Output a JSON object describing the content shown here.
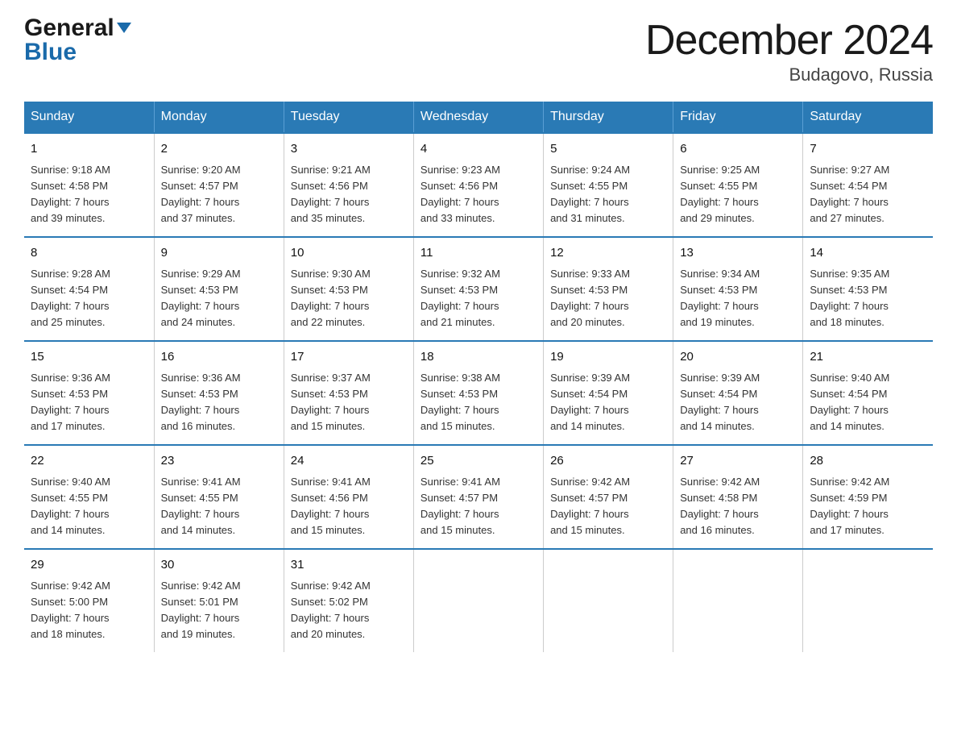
{
  "logo": {
    "general": "General",
    "blue": "Blue"
  },
  "title": {
    "month_year": "December 2024",
    "location": "Budagovo, Russia"
  },
  "days_of_week": [
    "Sunday",
    "Monday",
    "Tuesday",
    "Wednesday",
    "Thursday",
    "Friday",
    "Saturday"
  ],
  "weeks": [
    [
      {
        "day": "1",
        "sunrise": "9:18 AM",
        "sunset": "4:58 PM",
        "daylight": "7 hours and 39 minutes."
      },
      {
        "day": "2",
        "sunrise": "9:20 AM",
        "sunset": "4:57 PM",
        "daylight": "7 hours and 37 minutes."
      },
      {
        "day": "3",
        "sunrise": "9:21 AM",
        "sunset": "4:56 PM",
        "daylight": "7 hours and 35 minutes."
      },
      {
        "day": "4",
        "sunrise": "9:23 AM",
        "sunset": "4:56 PM",
        "daylight": "7 hours and 33 minutes."
      },
      {
        "day": "5",
        "sunrise": "9:24 AM",
        "sunset": "4:55 PM",
        "daylight": "7 hours and 31 minutes."
      },
      {
        "day": "6",
        "sunrise": "9:25 AM",
        "sunset": "4:55 PM",
        "daylight": "7 hours and 29 minutes."
      },
      {
        "day": "7",
        "sunrise": "9:27 AM",
        "sunset": "4:54 PM",
        "daylight": "7 hours and 27 minutes."
      }
    ],
    [
      {
        "day": "8",
        "sunrise": "9:28 AM",
        "sunset": "4:54 PM",
        "daylight": "7 hours and 25 minutes."
      },
      {
        "day": "9",
        "sunrise": "9:29 AM",
        "sunset": "4:53 PM",
        "daylight": "7 hours and 24 minutes."
      },
      {
        "day": "10",
        "sunrise": "9:30 AM",
        "sunset": "4:53 PM",
        "daylight": "7 hours and 22 minutes."
      },
      {
        "day": "11",
        "sunrise": "9:32 AM",
        "sunset": "4:53 PM",
        "daylight": "7 hours and 21 minutes."
      },
      {
        "day": "12",
        "sunrise": "9:33 AM",
        "sunset": "4:53 PM",
        "daylight": "7 hours and 20 minutes."
      },
      {
        "day": "13",
        "sunrise": "9:34 AM",
        "sunset": "4:53 PM",
        "daylight": "7 hours and 19 minutes."
      },
      {
        "day": "14",
        "sunrise": "9:35 AM",
        "sunset": "4:53 PM",
        "daylight": "7 hours and 18 minutes."
      }
    ],
    [
      {
        "day": "15",
        "sunrise": "9:36 AM",
        "sunset": "4:53 PM",
        "daylight": "7 hours and 17 minutes."
      },
      {
        "day": "16",
        "sunrise": "9:36 AM",
        "sunset": "4:53 PM",
        "daylight": "7 hours and 16 minutes."
      },
      {
        "day": "17",
        "sunrise": "9:37 AM",
        "sunset": "4:53 PM",
        "daylight": "7 hours and 15 minutes."
      },
      {
        "day": "18",
        "sunrise": "9:38 AM",
        "sunset": "4:53 PM",
        "daylight": "7 hours and 15 minutes."
      },
      {
        "day": "19",
        "sunrise": "9:39 AM",
        "sunset": "4:54 PM",
        "daylight": "7 hours and 14 minutes."
      },
      {
        "day": "20",
        "sunrise": "9:39 AM",
        "sunset": "4:54 PM",
        "daylight": "7 hours and 14 minutes."
      },
      {
        "day": "21",
        "sunrise": "9:40 AM",
        "sunset": "4:54 PM",
        "daylight": "7 hours and 14 minutes."
      }
    ],
    [
      {
        "day": "22",
        "sunrise": "9:40 AM",
        "sunset": "4:55 PM",
        "daylight": "7 hours and 14 minutes."
      },
      {
        "day": "23",
        "sunrise": "9:41 AM",
        "sunset": "4:55 PM",
        "daylight": "7 hours and 14 minutes."
      },
      {
        "day": "24",
        "sunrise": "9:41 AM",
        "sunset": "4:56 PM",
        "daylight": "7 hours and 15 minutes."
      },
      {
        "day": "25",
        "sunrise": "9:41 AM",
        "sunset": "4:57 PM",
        "daylight": "7 hours and 15 minutes."
      },
      {
        "day": "26",
        "sunrise": "9:42 AM",
        "sunset": "4:57 PM",
        "daylight": "7 hours and 15 minutes."
      },
      {
        "day": "27",
        "sunrise": "9:42 AM",
        "sunset": "4:58 PM",
        "daylight": "7 hours and 16 minutes."
      },
      {
        "day": "28",
        "sunrise": "9:42 AM",
        "sunset": "4:59 PM",
        "daylight": "7 hours and 17 minutes."
      }
    ],
    [
      {
        "day": "29",
        "sunrise": "9:42 AM",
        "sunset": "5:00 PM",
        "daylight": "7 hours and 18 minutes."
      },
      {
        "day": "30",
        "sunrise": "9:42 AM",
        "sunset": "5:01 PM",
        "daylight": "7 hours and 19 minutes."
      },
      {
        "day": "31",
        "sunrise": "9:42 AM",
        "sunset": "5:02 PM",
        "daylight": "7 hours and 20 minutes."
      },
      null,
      null,
      null,
      null
    ]
  ],
  "labels": {
    "sunrise": "Sunrise:",
    "sunset": "Sunset:",
    "daylight": "Daylight:"
  }
}
